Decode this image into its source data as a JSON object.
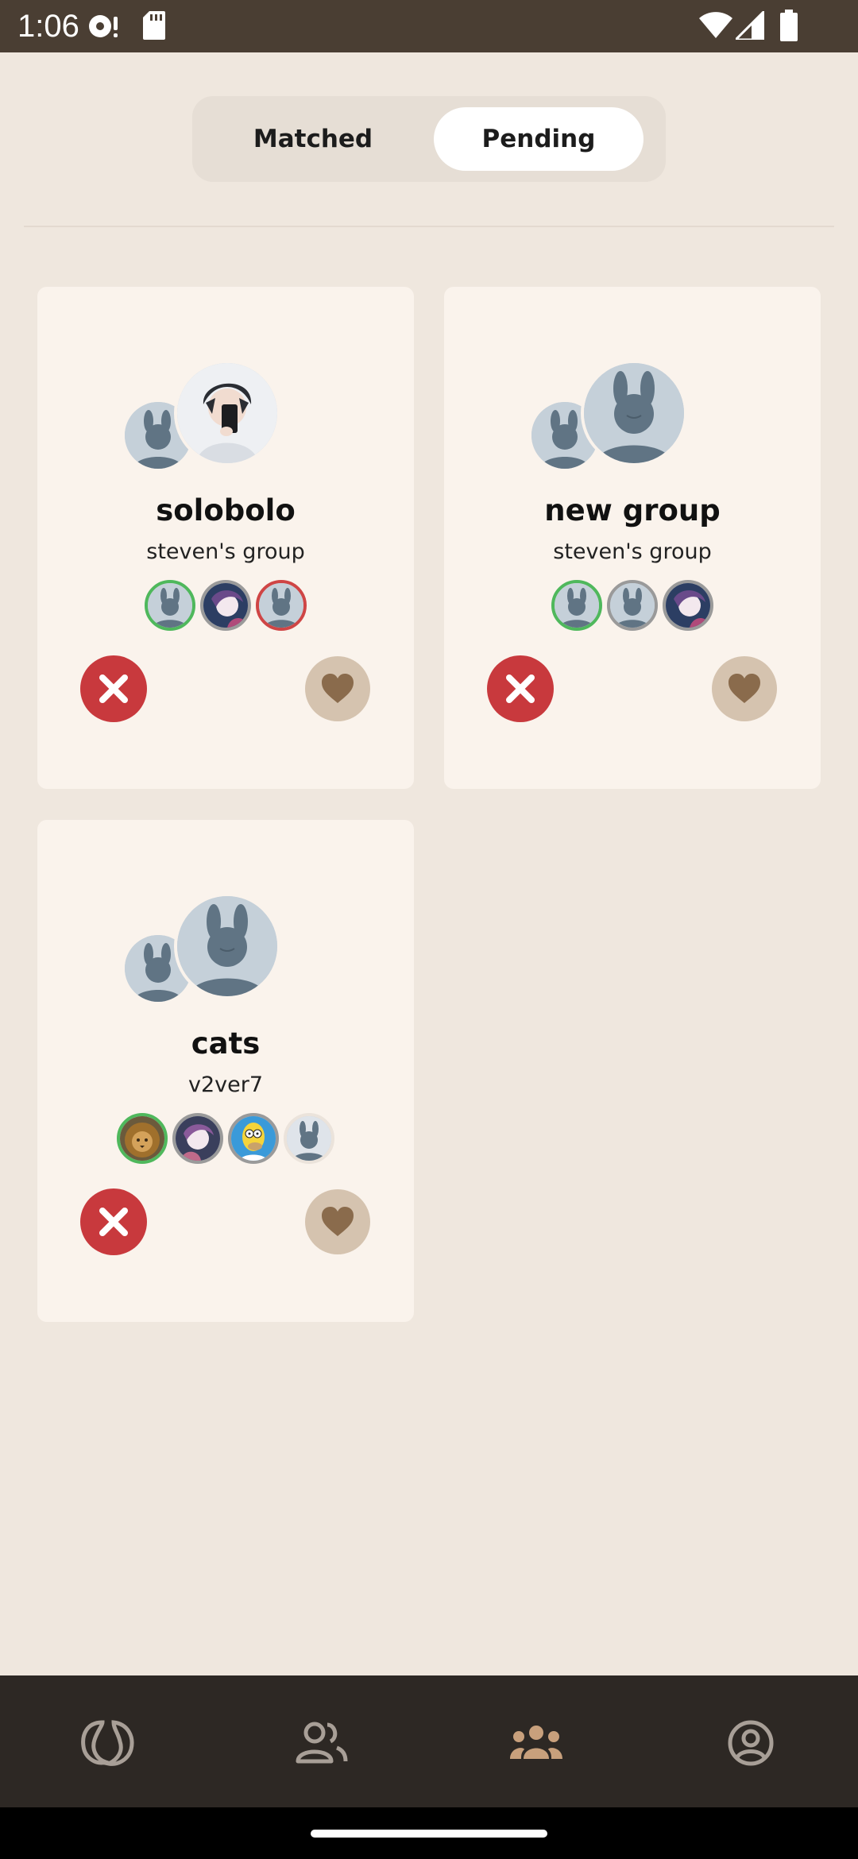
{
  "status_bar": {
    "time": "1:06"
  },
  "tabs": {
    "matched": "Matched",
    "pending": "Pending",
    "active": "pending"
  },
  "groups": [
    {
      "name": "solobolo",
      "owner": "steven's group",
      "lead_avatar": "dark-haired person taking mirror selfie",
      "members": [
        "green",
        "gray",
        "red"
      ]
    },
    {
      "name": "new group",
      "owner": "steven's group",
      "lead_avatar": "default bunny avatar",
      "members": [
        "green",
        "gray",
        "gray"
      ]
    },
    {
      "name": "cats",
      "owner": "v2ver7",
      "lead_avatar": "default bunny avatar",
      "members": [
        "green",
        "gray",
        "gray",
        "light"
      ]
    }
  ],
  "nav": {
    "items": [
      "discover-icon",
      "friends-icon",
      "groups-icon",
      "profile-icon"
    ],
    "active": "groups-icon"
  },
  "colors": {
    "background": "#efe7de",
    "card": "#faf3ec",
    "reject": "#c8393d",
    "like": "#d5c3af",
    "heart": "#8a6b4c",
    "nav_bg": "#2d2824",
    "nav_active": "#c8a07c",
    "nav_inactive": "#a89f97"
  }
}
